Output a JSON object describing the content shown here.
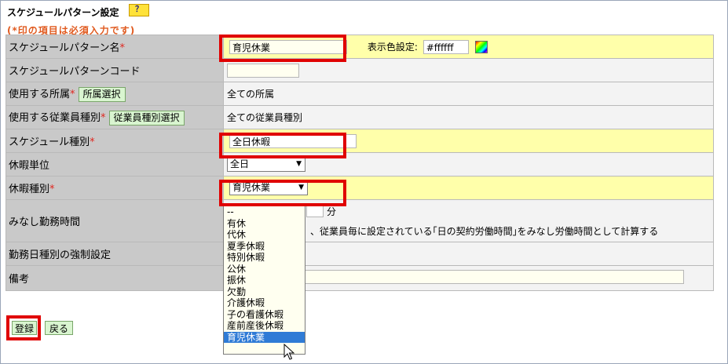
{
  "page": {
    "title": "スケジュールパターン設定",
    "help_label": "？",
    "required_note": "(*印の項目は必須入力です)"
  },
  "rows": {
    "pattern_name": {
      "label": "スケジュールパターン名",
      "required": "*",
      "value": "育児休業",
      "color_label": "表示色設定:",
      "color_value": "#ffffff"
    },
    "pattern_code": {
      "label": "スケジュールパターンコード",
      "value": ""
    },
    "department": {
      "label": "使用する所属",
      "required": "*",
      "button": "所属選択",
      "value": "全ての所属"
    },
    "employee_type": {
      "label": "使用する従業員種別",
      "required": "*",
      "button": "従業員種別選択",
      "value": "全ての従業員種別"
    },
    "schedule_type": {
      "label": "スケジュール種別",
      "required": "*",
      "value": "全日休暇"
    },
    "leave_unit": {
      "label": "休暇単位",
      "value": "全日"
    },
    "leave_type": {
      "label": "休暇種別",
      "required": "*",
      "value": "育児休業"
    },
    "deemed_hours": {
      "label": "みなし勤務時間",
      "unit": "分",
      "note": "、従業員毎に設定されている｢日の契約労働時間｣をみなし労働時間として計算する"
    },
    "forced_workday": {
      "label": "勤務日種別の強制設定"
    },
    "remarks": {
      "label": "備考"
    }
  },
  "dropdown": {
    "options": [
      "--",
      "有休",
      "代休",
      "夏季休暇",
      "特別休暇",
      "公休",
      "振休",
      "欠勤",
      "介護休暇",
      "子の看護休暇",
      "産前産後休暇",
      "育児休業"
    ],
    "selected": "育児休業"
  },
  "footer": {
    "submit": "登録",
    "back": "戻る"
  },
  "colors": {
    "highlight": "#ffffaa",
    "label_bg": "#c9c9c9",
    "annotation": "#e00000",
    "selected": "#2f7bd6"
  }
}
